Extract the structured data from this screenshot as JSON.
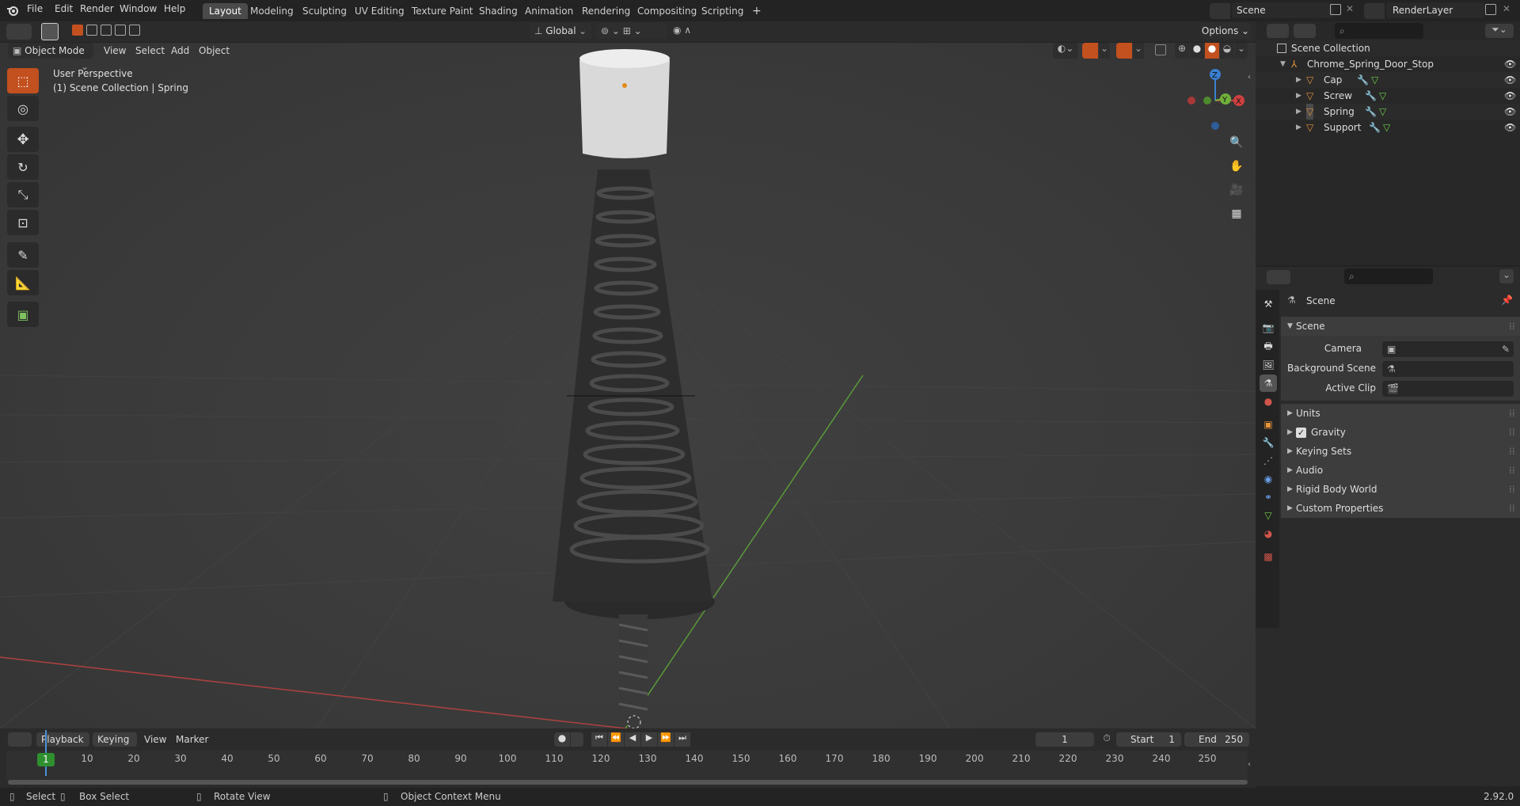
{
  "menu": {
    "items": [
      "File",
      "Edit",
      "Render",
      "Window",
      "Help"
    ]
  },
  "workspaces": {
    "tabs": [
      "Layout",
      "Modeling",
      "Sculpting",
      "UV Editing",
      "Texture Paint",
      "Shading",
      "Animation",
      "Rendering",
      "Compositing",
      "Scripting"
    ],
    "active": "Layout",
    "add": "+"
  },
  "scene_selector": {
    "value": "Scene"
  },
  "layer_selector": {
    "value": "RenderLayer"
  },
  "viewport": {
    "mode": "Object Mode",
    "menus": [
      "View",
      "Select",
      "Add",
      "Object"
    ],
    "transform": "Global",
    "options": "Options",
    "overlay_title": "User Perspective",
    "overlay_subtitle": "(1) Scene Collection | Spring",
    "gizmo": {
      "z": "Z",
      "x": "X",
      "y": "Y"
    }
  },
  "outliner": {
    "root": "Scene Collection",
    "collection": "Chrome_Spring_Door_Stop",
    "objects": [
      "Cap",
      "Screw",
      "Spring",
      "Support"
    ]
  },
  "properties": {
    "header": "Scene",
    "panel": "Scene",
    "fields": [
      {
        "label": "Camera",
        "value": ""
      },
      {
        "label": "Background Scene",
        "value": ""
      },
      {
        "label": "Active Clip",
        "value": ""
      }
    ],
    "subpanels": [
      "Units",
      "Gravity",
      "Keying Sets",
      "Audio",
      "Rigid Body World",
      "Custom Properties"
    ],
    "gravity_checked": true
  },
  "timeline": {
    "menus": [
      "Playback",
      "Keying",
      "View",
      "Marker"
    ],
    "current_frame": "1",
    "start_label": "Start",
    "start": "1",
    "end_label": "End",
    "end": "250",
    "ticks": [
      "1",
      "10",
      "20",
      "30",
      "40",
      "50",
      "60",
      "70",
      "80",
      "90",
      "100",
      "110",
      "120",
      "130",
      "140",
      "150",
      "160",
      "170",
      "180",
      "190",
      "200",
      "210",
      "220",
      "230",
      "240",
      "250"
    ]
  },
  "status": {
    "select": "Select",
    "box_select": "Box Select",
    "rotate": "Rotate View",
    "context": "Object Context Menu",
    "version": "2.92.0"
  },
  "colors": {
    "accent": "#c3501f",
    "selected_tab": "#4a4a4a",
    "x_axis": "#d04040",
    "y_axis": "#6fb03a",
    "z_axis": "#3a7fd0"
  }
}
